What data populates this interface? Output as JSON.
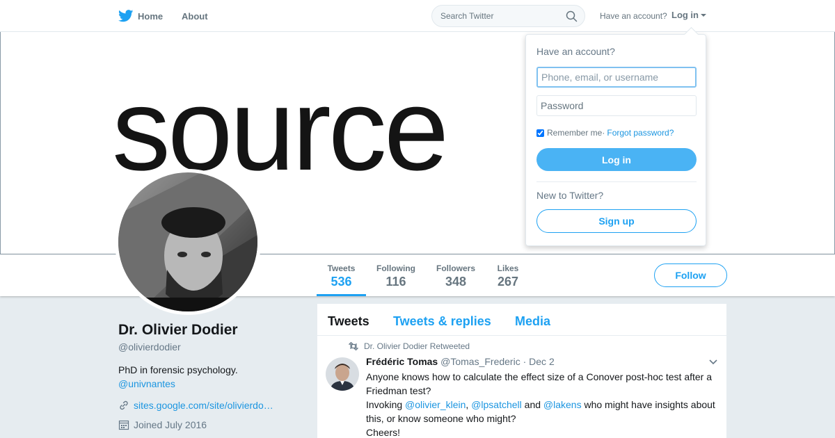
{
  "nav": {
    "home_label": "Home",
    "about_label": "About",
    "search_placeholder": "Search Twitter",
    "have_account": "Have an account?",
    "login_label": "Log in"
  },
  "banner": {
    "text": "source"
  },
  "profile": {
    "name": "Dr. Olivier Dodier",
    "handle": "@olivierdodier",
    "bio": "PhD in forensic psychology.",
    "bio_mention": "@univnantes",
    "website": "sites.google.com/site/olivierdo…",
    "joined": "Joined July 2016"
  },
  "stats": [
    {
      "label": "Tweets",
      "value": "536"
    },
    {
      "label": "Following",
      "value": "116"
    },
    {
      "label": "Followers",
      "value": "348"
    },
    {
      "label": "Likes",
      "value": "267"
    }
  ],
  "follow_label": "Follow",
  "timeline": {
    "tabs": [
      "Tweets",
      "Tweets & replies",
      "Media"
    ],
    "tweet": {
      "retweet_context": "Dr. Olivier Dodier Retweeted",
      "author": "Frédéric Tomas",
      "handle": "@Tomas_Frederic",
      "separator": " · ",
      "date": "Dec 2",
      "line1": "Anyone knows how to calculate the effect size of a Conover post-hoc test after a Friedman test?",
      "line2_prefix": "Invoking ",
      "mention1": "@olivier_klein",
      "comma": ", ",
      "mention2": "@lpsatchell",
      "and": " and ",
      "mention3": "@lakens",
      "line2_suffix": " who might have insights about this, or know someone who might?",
      "line3": "Cheers!"
    }
  },
  "login_dropdown": {
    "heading": "Have an account?",
    "username_placeholder": "Phone, email, or username",
    "password_placeholder": "Password",
    "remember_label": "Remember me",
    "dot": " ·",
    "forgot_label": "Forgot password?",
    "login_button": "Log in",
    "new_label": "New to Twitter?",
    "signup_button": "Sign up"
  },
  "colors": {
    "accent": "#1da1f2",
    "login_button": "#4ab3f4",
    "background": "#e6ecf0"
  },
  "icons": [
    "twitter-bird-icon",
    "search-icon",
    "caret-down-icon",
    "retweet-icon",
    "chevron-down-icon",
    "link-icon",
    "calendar-icon"
  ]
}
